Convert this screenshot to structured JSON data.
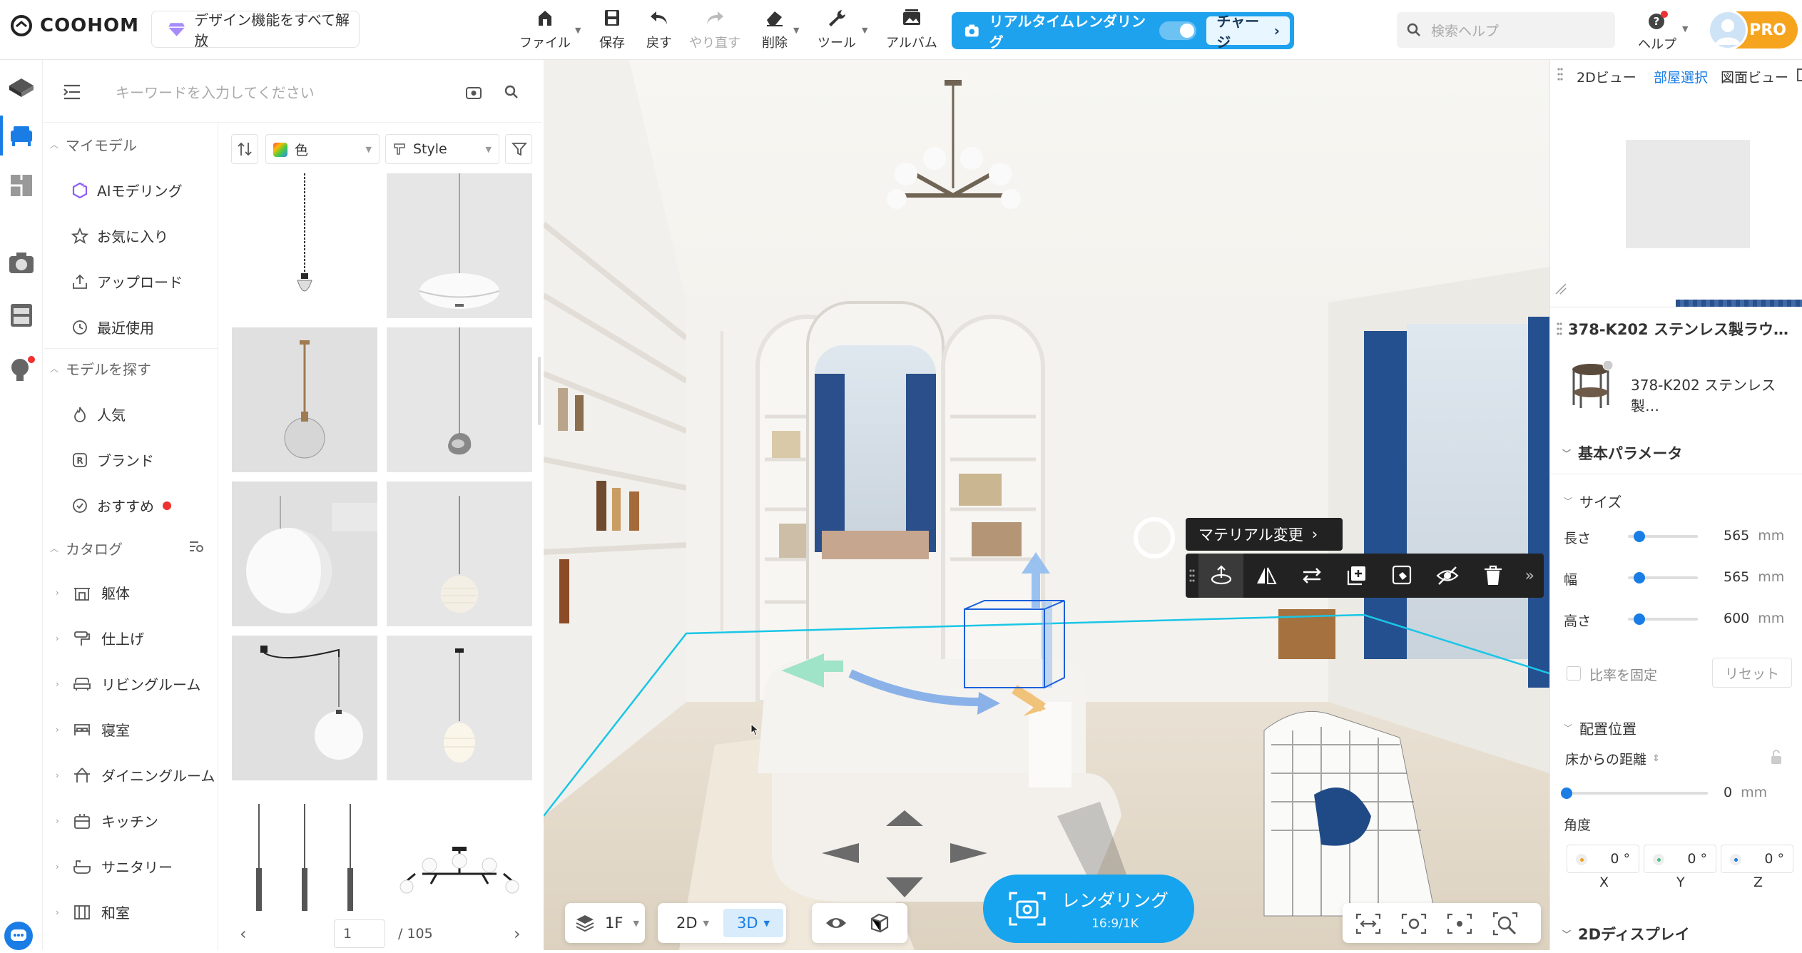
{
  "topbar": {
    "brand": "COOHOM",
    "unlock_label": "デザイン機能をすべて解放",
    "tools": [
      {
        "label": "ファイル",
        "icon": "home-icon"
      },
      {
        "label": "保存",
        "icon": "save-icon"
      },
      {
        "label": "戻す",
        "icon": "undo-icon"
      },
      {
        "label": "やり直す",
        "icon": "redo-icon"
      },
      {
        "label": "削除",
        "icon": "eraser-icon"
      },
      {
        "label": "ツール",
        "icon": "wrench-icon"
      },
      {
        "label": "アルバム",
        "icon": "album-icon"
      }
    ],
    "realtime_label": "リアルタイムレンダリング",
    "charge_label": "チャージ",
    "search_placeholder": "検索ヘルプ",
    "help_label": "ヘルプ",
    "pro_label": "PRO"
  },
  "sidebar": {
    "search_placeholder": "キーワードを入力してください",
    "my_models": {
      "title": "マイモデル",
      "items": [
        "AIモデリング",
        "お気に入り",
        "アップロード",
        "最近使用"
      ]
    },
    "find_models": {
      "title": "モデルを探す",
      "items": [
        "人気",
        "ブランド",
        "おすすめ"
      ]
    },
    "catalog": {
      "title": "カタログ",
      "items": [
        "躯体",
        "仕上げ",
        "リビングルーム",
        "寝室",
        "ダイニングルーム",
        "キッチン",
        "サニタリー",
        "和室"
      ]
    }
  },
  "grid": {
    "filter_color": "色",
    "filter_style": "Style",
    "page_current": "1",
    "page_total": "/ 105"
  },
  "viewport": {
    "tooltip": "マテリアル変更",
    "floor": "1F",
    "mode_2d": "2D",
    "mode_3d": "3D",
    "render_label": "レンダリング",
    "render_sub": "16:9/1K"
  },
  "right_panel": {
    "tabs": [
      "2Dビュー",
      "部屋選択",
      "図面ビュー"
    ],
    "active_tab": "部屋選択",
    "title": "378-K202 ステンレス製ラウ…",
    "item_name": "378-K202 ステンレス製…",
    "basic_params": "基本パラメータ",
    "size_section": "サイズ",
    "length_label": "長さ",
    "length_value": "565",
    "width_label": "幅",
    "width_value": "565",
    "height_label": "高さ",
    "height_value": "600",
    "unit": "mm",
    "lock_ratio": "比率を固定",
    "reset": "リセット",
    "placement": "配置位置",
    "floor_dist_label": "床からの距離",
    "floor_dist_value": "0",
    "angle_label": "角度",
    "angle_x": "0",
    "angle_y": "0",
    "angle_z": "0",
    "degree": "°",
    "axis_x": "X",
    "axis_y": "Y",
    "axis_z": "Z",
    "display_2d": "2Dディスプレイ"
  },
  "colors": {
    "accent": "#1fa2ee",
    "pro": "#f6a41e",
    "selection": "#1a7de6"
  }
}
